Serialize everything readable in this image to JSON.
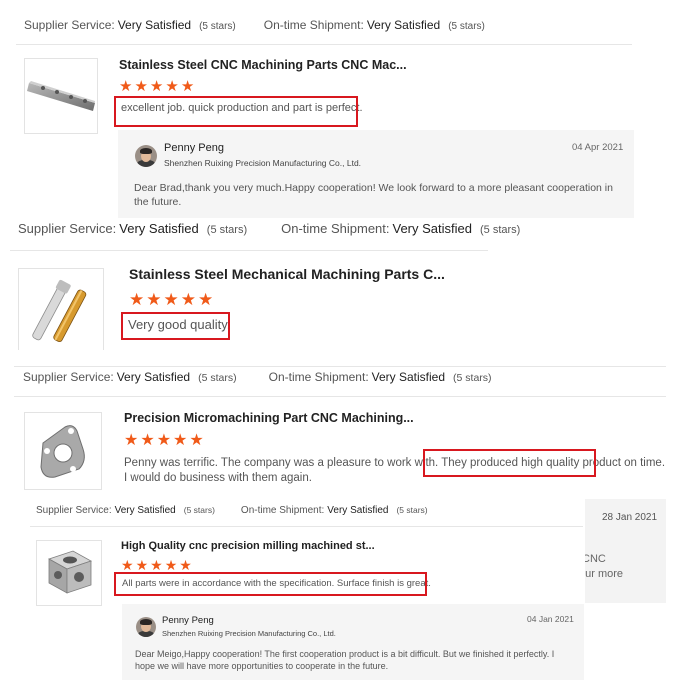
{
  "block1": {
    "supplier_label": "Supplier Service:",
    "supplier_value": "Very Satisfied",
    "supplier_stars": "(5 stars)",
    "shipment_label": "On-time Shipment:",
    "shipment_value": "Very Satisfied",
    "shipment_stars": "(5 stars)",
    "product_title": "Stainless Steel CNC Machining Parts CNC Mac...",
    "rating": 5,
    "review": "excellent job. quick production and part is perfect.",
    "reply": {
      "name": "Penny Peng",
      "company": "Shenzhen Ruixing Precision Manufacturing Co., Ltd.",
      "date": "04 Apr 2021",
      "text": "Dear Brad,thank you very much.Happy cooperation! We look forward to a more pleasant cooperation in the future."
    }
  },
  "block2": {
    "supplier_label": "Supplier Service:",
    "supplier_value": "Very Satisfied",
    "supplier_stars": "(5 stars)",
    "shipment_label": "On-time Shipment:",
    "shipment_value": "Very Satisfied",
    "shipment_stars": "(5 stars)",
    "product_title": "Stainless Steel Mechanical Machining Parts C...",
    "rating": 5,
    "review": "Very good quality."
  },
  "block3": {
    "supplier_label": "Supplier Service:",
    "supplier_value": "Very Satisfied",
    "supplier_stars": "(5 stars)",
    "shipment_label": "On-time Shipment:",
    "shipment_value": "Very Satisfied",
    "shipment_stars": "(5 stars)",
    "product_title": "Precision Micromachining Part CNC Machining...",
    "rating": 5,
    "review_line1_a": "Penny was terrific.  The company was a pleasure to work with. ",
    "review_line1_b": "They produced high quality product",
    "review_line1_c": " on time.",
    "review_line2": "I would do business with them again."
  },
  "block3_bg": {
    "date": "28 Jan 2021",
    "frag1": "CNC",
    "frag2": "our more"
  },
  "block4": {
    "supplier_label": "Supplier Service:",
    "supplier_value": "Very Satisfied",
    "supplier_stars": "(5 stars)",
    "shipment_label": "On-time Shipment:",
    "shipment_value": "Very Satisfied",
    "shipment_stars": "(5 stars)",
    "product_title": "High Quality cnc precision milling machined st...",
    "rating": 5,
    "review": "All parts were in accordance with the specification. Surface finish is great.",
    "reply": {
      "name": "Penny Peng",
      "company": "Shenzhen Ruixing Precision Manufacturing Co., Ltd.",
      "date": "04 Jan 2021",
      "text": "Dear Meigo,Happy cooperation! The first cooperation product is a bit difficult. But we finished it perfectly. I hope we will have more opportunities to cooperate in the future."
    }
  },
  "colors": {
    "star": "#f05a19",
    "highlight": "#d8181f",
    "reply_bg": "#f5f5f5"
  }
}
